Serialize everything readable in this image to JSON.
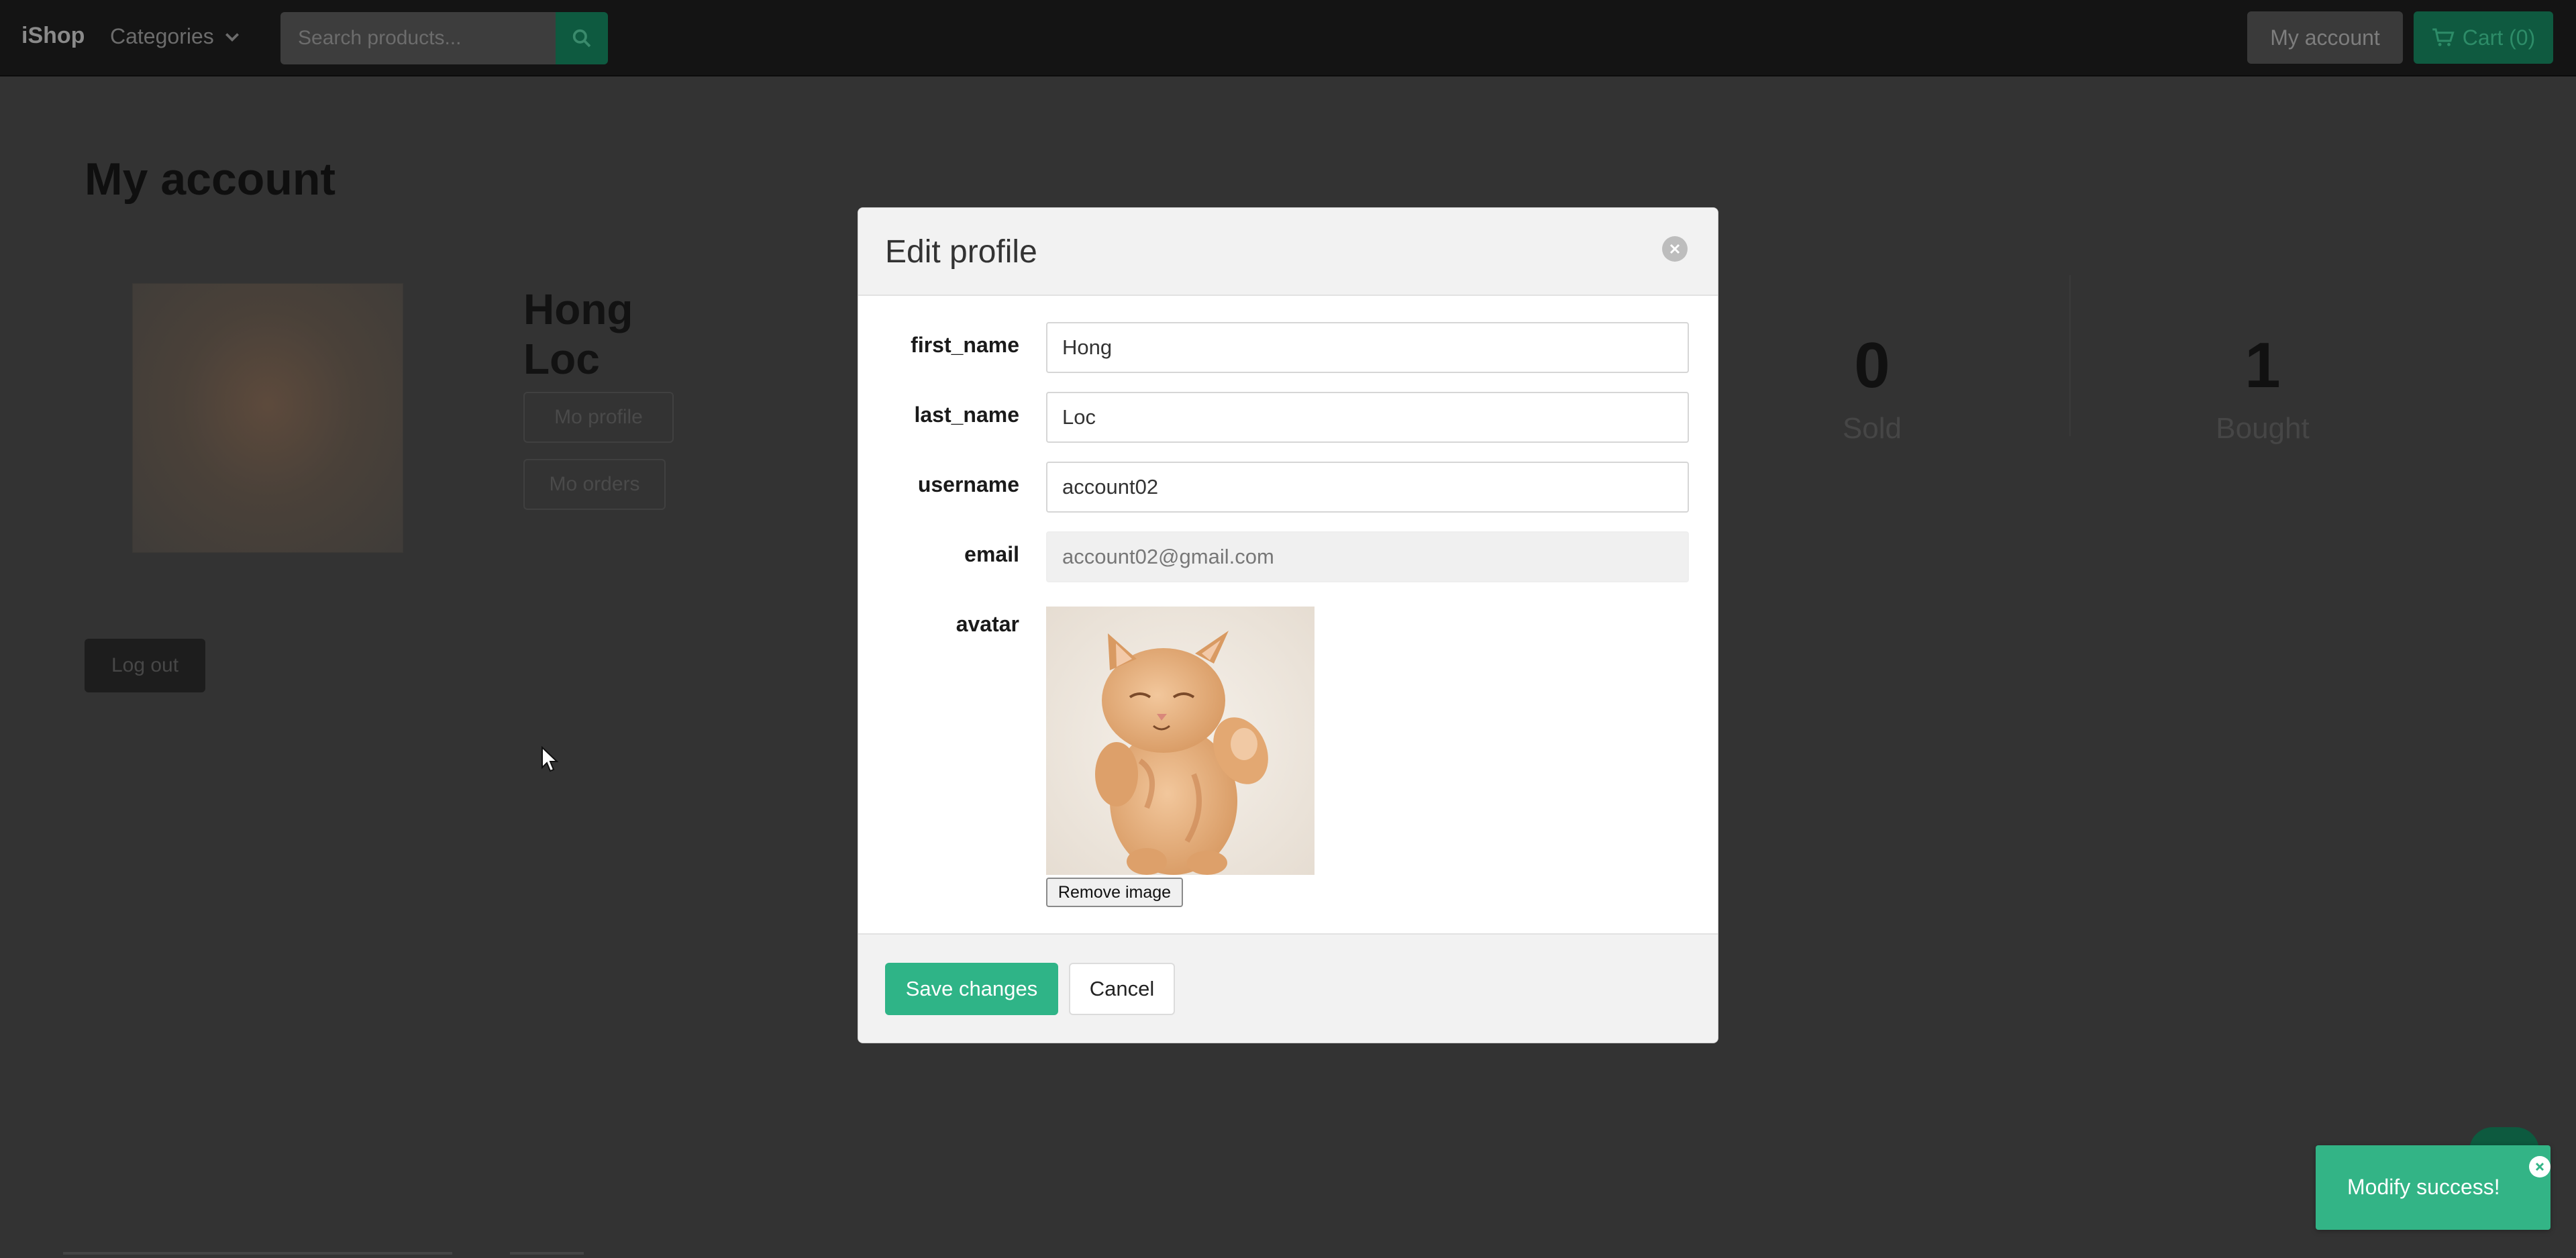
{
  "navbar": {
    "brand": "iShop",
    "categories_label": "Categories",
    "search_placeholder": "Search products...",
    "my_account_label": "My account",
    "cart_label": "Cart (0)"
  },
  "page": {
    "title": "My account",
    "user_name_line1": "Hong",
    "user_name_line2": "Loc",
    "btn1_label": "Mo profile",
    "btn2_label": "Mo orders",
    "logout_label": "Log out",
    "stats": [
      {
        "value": "0",
        "label": "Sold"
      },
      {
        "value": "1",
        "label": "Bought"
      }
    ]
  },
  "modal": {
    "title": "Edit profile",
    "fields": [
      {
        "label": "first_name",
        "value": "Hong"
      },
      {
        "label": "last_name",
        "value": "Loc"
      },
      {
        "label": "username",
        "value": "account02"
      },
      {
        "label": "email",
        "value": "account02@gmail.com"
      }
    ],
    "avatar_label": "avatar",
    "remove_image_label": "Remove image",
    "save_label": "Save changes",
    "cancel_label": "Cancel"
  },
  "toast": {
    "message": "Modify success!"
  },
  "colors": {
    "primary": "#2fb487",
    "overlay_bg": "#333333",
    "navbar_bg": "#141414"
  }
}
